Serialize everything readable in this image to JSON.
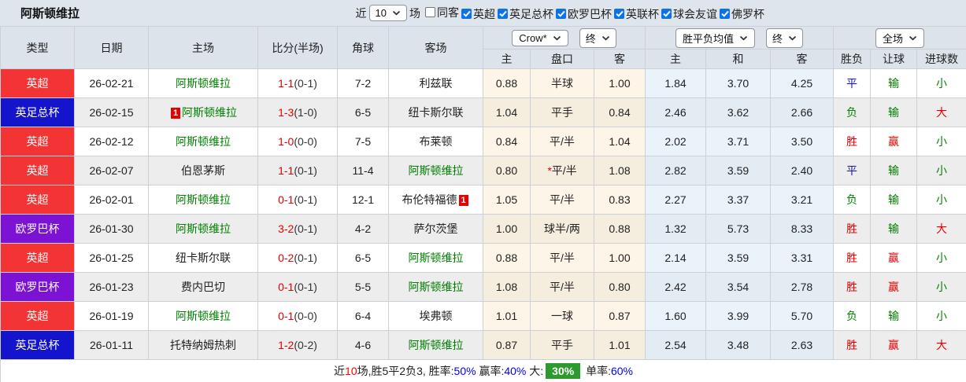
{
  "title": "阿斯顿维拉",
  "topbar": {
    "near_label": "近",
    "matches_value": "10",
    "games_label": "场",
    "checkboxes": [
      {
        "label": "同客",
        "checked": false
      },
      {
        "label": "英超",
        "checked": true
      },
      {
        "label": "英足总杯",
        "checked": true
      },
      {
        "label": "欧罗巴杯",
        "checked": true
      },
      {
        "label": "英联杯",
        "checked": true
      },
      {
        "label": "球会友谊",
        "checked": true
      },
      {
        "label": "佛罗杯",
        "checked": true
      }
    ]
  },
  "table": {
    "main_headers": [
      "类型",
      "日期",
      "主场",
      "比分(半场)",
      "角球",
      "客场"
    ],
    "sub_headers": [
      "主",
      "盘口",
      "客",
      "主",
      "和",
      "客",
      "胜负",
      "让球",
      "进球数"
    ],
    "selects": {
      "odds_source": "Crow*",
      "odds_time": "终",
      "mean_label": "胜平负均值",
      "mean_time": "终",
      "scope": "全场"
    },
    "rows": [
      {
        "league": "英超",
        "league_color": "red",
        "date": "26-02-21",
        "home": "阿斯顿维拉",
        "home_green": true,
        "home_card": "",
        "away": "利兹联",
        "away_green": false,
        "away_card": "",
        "score": "1-1",
        "half": "(0-1)",
        "corners": "7-2",
        "crow_home": "0.88",
        "handicap": "半球",
        "handicap_star": false,
        "crow_away": "1.00",
        "mean_home": "1.84",
        "mean_draw": "3.70",
        "mean_away": "4.25",
        "result": "平",
        "result_color": "blue",
        "cover": "输",
        "cover_color": "green",
        "goals": "小",
        "goals_color": "green"
      },
      {
        "league": "英足总杯",
        "league_color": "blue",
        "date": "26-02-15",
        "home": "阿斯顿维拉",
        "home_green": true,
        "home_card": "1",
        "away": "纽卡斯尔联",
        "away_green": false,
        "away_card": "",
        "score": "1-3",
        "half": "(1-0)",
        "corners": "6-5",
        "crow_home": "1.04",
        "handicap": "平手",
        "handicap_star": false,
        "crow_away": "0.84",
        "mean_home": "2.46",
        "mean_draw": "3.62",
        "mean_away": "2.66",
        "result": "负",
        "result_color": "green",
        "cover": "输",
        "cover_color": "green",
        "goals": "大",
        "goals_color": "red"
      },
      {
        "league": "英超",
        "league_color": "red",
        "date": "26-02-12",
        "home": "阿斯顿维拉",
        "home_green": true,
        "home_card": "",
        "away": "布莱顿",
        "away_green": false,
        "away_card": "",
        "score": "1-0",
        "half": "(0-0)",
        "corners": "7-5",
        "crow_home": "0.84",
        "handicap": "平/半",
        "handicap_star": false,
        "crow_away": "1.04",
        "mean_home": "2.02",
        "mean_draw": "3.71",
        "mean_away": "3.50",
        "result": "胜",
        "result_color": "red",
        "cover": "赢",
        "cover_color": "red",
        "goals": "小",
        "goals_color": "green"
      },
      {
        "league": "英超",
        "league_color": "red",
        "date": "26-02-07",
        "home": "伯恩茅斯",
        "home_green": false,
        "home_card": "",
        "away": "阿斯顿维拉",
        "away_green": true,
        "away_card": "",
        "score": "1-1",
        "half": "(0-1)",
        "corners": "11-4",
        "crow_home": "0.80",
        "handicap": "平/半",
        "handicap_star": true,
        "crow_away": "1.08",
        "mean_home": "2.82",
        "mean_draw": "3.59",
        "mean_away": "2.40",
        "result": "平",
        "result_color": "blue",
        "cover": "输",
        "cover_color": "green",
        "goals": "小",
        "goals_color": "green"
      },
      {
        "league": "英超",
        "league_color": "red",
        "date": "26-02-01",
        "home": "阿斯顿维拉",
        "home_green": true,
        "home_card": "",
        "away": "布伦特福德",
        "away_green": false,
        "away_card": "1",
        "score": "0-1",
        "half": "(0-1)",
        "corners": "12-1",
        "crow_home": "1.05",
        "handicap": "平/半",
        "handicap_star": false,
        "crow_away": "0.83",
        "mean_home": "2.27",
        "mean_draw": "3.37",
        "mean_away": "3.21",
        "result": "负",
        "result_color": "green",
        "cover": "输",
        "cover_color": "green",
        "goals": "小",
        "goals_color": "green"
      },
      {
        "league": "欧罗巴杯",
        "league_color": "purple",
        "date": "26-01-30",
        "home": "阿斯顿维拉",
        "home_green": true,
        "home_card": "",
        "away": "萨尔茨堡",
        "away_green": false,
        "away_card": "",
        "score": "3-2",
        "half": "(0-1)",
        "corners": "4-2",
        "crow_home": "1.00",
        "handicap": "球半/两",
        "handicap_star": false,
        "crow_away": "0.88",
        "mean_home": "1.32",
        "mean_draw": "5.73",
        "mean_away": "8.33",
        "result": "胜",
        "result_color": "red",
        "cover": "输",
        "cover_color": "green",
        "goals": "大",
        "goals_color": "red"
      },
      {
        "league": "英超",
        "league_color": "red",
        "date": "26-01-25",
        "home": "纽卡斯尔联",
        "home_green": false,
        "home_card": "",
        "away": "阿斯顿维拉",
        "away_green": true,
        "away_card": "",
        "score": "0-2",
        "half": "(0-1)",
        "corners": "6-5",
        "crow_home": "0.88",
        "handicap": "平/半",
        "handicap_star": false,
        "crow_away": "1.00",
        "mean_home": "2.14",
        "mean_draw": "3.59",
        "mean_away": "3.31",
        "result": "胜",
        "result_color": "red",
        "cover": "赢",
        "cover_color": "red",
        "goals": "小",
        "goals_color": "green"
      },
      {
        "league": "欧罗巴杯",
        "league_color": "purple",
        "date": "26-01-23",
        "home": "费内巴切",
        "home_green": false,
        "home_card": "",
        "away": "阿斯顿维拉",
        "away_green": true,
        "away_card": "",
        "score": "0-1",
        "half": "(0-1)",
        "corners": "5-5",
        "crow_home": "1.08",
        "handicap": "平/半",
        "handicap_star": false,
        "crow_away": "0.80",
        "mean_home": "2.42",
        "mean_draw": "3.54",
        "mean_away": "2.78",
        "result": "胜",
        "result_color": "red",
        "cover": "赢",
        "cover_color": "red",
        "goals": "小",
        "goals_color": "green"
      },
      {
        "league": "英超",
        "league_color": "red",
        "date": "26-01-19",
        "home": "阿斯顿维拉",
        "home_green": true,
        "home_card": "",
        "away": "埃弗顿",
        "away_green": false,
        "away_card": "",
        "score": "0-1",
        "half": "(0-0)",
        "corners": "6-4",
        "crow_home": "1.01",
        "handicap": "一球",
        "handicap_star": false,
        "crow_away": "0.87",
        "mean_home": "1.60",
        "mean_draw": "3.99",
        "mean_away": "5.70",
        "result": "负",
        "result_color": "green",
        "cover": "输",
        "cover_color": "green",
        "goals": "小",
        "goals_color": "green"
      },
      {
        "league": "英足总杯",
        "league_color": "blue",
        "date": "26-01-11",
        "home": "托特纳姆热刺",
        "home_green": false,
        "home_card": "",
        "away": "阿斯顿维拉",
        "away_green": true,
        "away_card": "",
        "score": "1-2",
        "half": "(0-2)",
        "corners": "4-6",
        "crow_home": "0.87",
        "handicap": "平手",
        "handicap_star": false,
        "crow_away": "1.01",
        "mean_home": "2.54",
        "mean_draw": "3.48",
        "mean_away": "2.63",
        "result": "胜",
        "result_color": "red",
        "cover": "赢",
        "cover_color": "red",
        "goals": "大",
        "goals_color": "red"
      }
    ]
  },
  "summary": {
    "segments": [
      {
        "text": "近",
        "style": "plain"
      },
      {
        "text": "10",
        "style": "red"
      },
      {
        "text": "场,胜5平2负3, 胜率:",
        "style": "plain"
      },
      {
        "text": "50%",
        "style": "blue"
      },
      {
        "text": " 赢率:",
        "style": "plain"
      },
      {
        "text": "40%",
        "style": "blue"
      },
      {
        "text": " 大:",
        "style": "plain"
      },
      {
        "text": "30%",
        "style": "greenbox"
      },
      {
        "text": " 单率:",
        "style": "plain"
      },
      {
        "text": "60%",
        "style": "blue"
      }
    ]
  },
  "colors": {
    "league_red": "#f23434",
    "league_blue": "#1414cc",
    "league_purple": "#7b12d4",
    "win_red": "#e60000",
    "draw_blue": "#1414cc",
    "lose_green": "#008000",
    "highlight_green": "#2c9a2c",
    "checkbox_blue": "#0b72e8"
  }
}
